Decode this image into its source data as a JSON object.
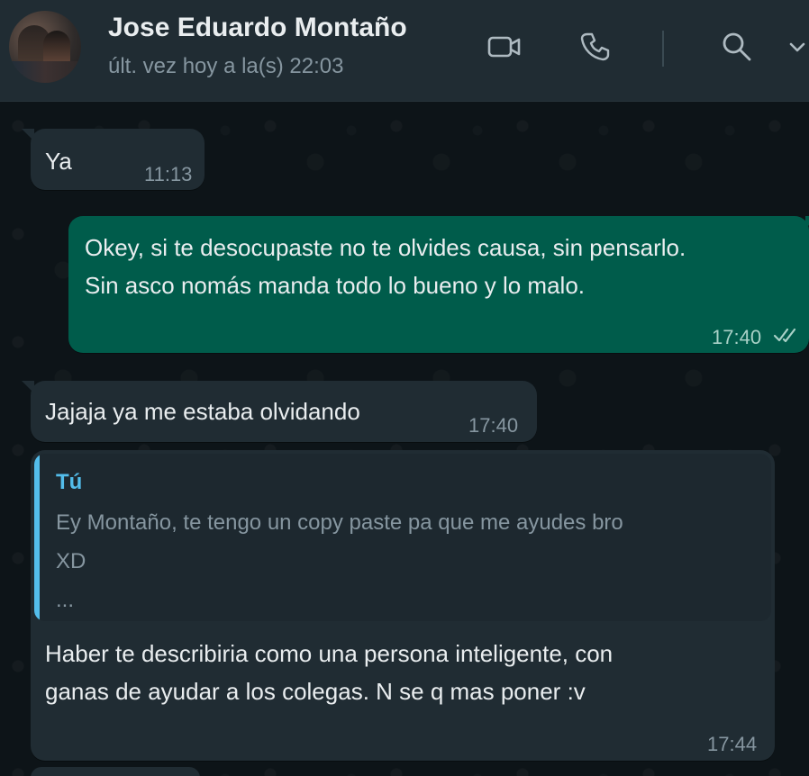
{
  "header": {
    "contact_name": "Jose Eduardo Montaño",
    "last_seen": "últ. vez hoy a la(s) 22:03",
    "icons": [
      "video-call-icon",
      "voice-call-icon",
      "search-icon",
      "chevron-down-icon"
    ]
  },
  "messages": [
    {
      "direction": "incoming",
      "text": "Ya",
      "time": "11:13"
    },
    {
      "direction": "outgoing",
      "text": "Okey, si te desocupaste no te olvides causa, sin pensarlo.\nSin asco nomás manda todo lo bueno y lo malo.",
      "time": "17:40",
      "status_icon": "double-check-icon"
    },
    {
      "direction": "incoming",
      "text": "Jajaja ya me estaba olvidando",
      "time": "17:40"
    },
    {
      "direction": "incoming",
      "quote": {
        "author": "Tú",
        "text": "Ey Montaño, te tengo un copy paste pa que me ayudes bro\nXD\n..."
      },
      "text": "Haber te describiria como una persona inteligente, con\nganas de ayudar a los colegas. N se q mas poner :v",
      "time": "17:44"
    }
  ],
  "colors": {
    "header_bg": "#202c33",
    "incoming_bg": "#202c33",
    "outgoing_bg": "#005c4b",
    "quote_accent": "#53bdeb",
    "chat_bg": "#0d1418"
  }
}
